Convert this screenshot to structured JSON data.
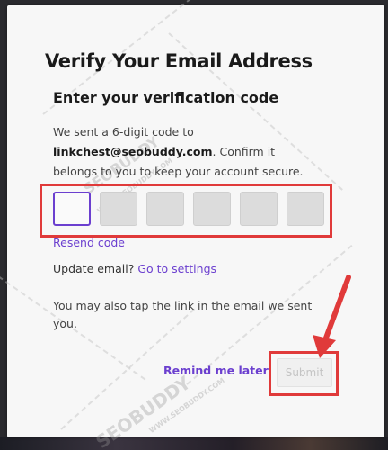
{
  "modal": {
    "title": "Verify Your Email Address",
    "subtitle": "Enter your verification code",
    "desc_prefix": "We sent a 6-digit code to",
    "email": "linkchest@seobuddy.com",
    "desc_suffix": ". Confirm it belongs to you to keep your account secure.",
    "code_digits": [
      "",
      "",
      "",
      "",
      "",
      ""
    ],
    "resend_label": "Resend code",
    "update_prefix": "Update email?",
    "update_link": "Go to settings",
    "tap_note": "You may also tap the link in the email we sent you.",
    "remind_label": "Remind me later",
    "submit_label": "Submit"
  },
  "watermark": {
    "brand": "SEOBUDDY",
    "domain": "WWW.SEOBUDDY.COM"
  },
  "colors": {
    "accent": "#6b3fcf",
    "annotation": "#e03a3a"
  }
}
